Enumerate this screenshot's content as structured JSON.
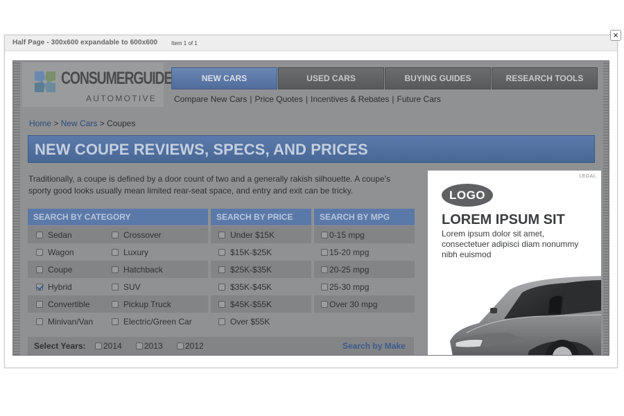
{
  "modal": {
    "title": "Half Page - 300x600 expandable to 600x600",
    "count": "Item 1 of 1",
    "close": "×"
  },
  "site": {
    "logo_title": "CONSUMERGUIDE",
    "logo_reg": "®",
    "logo_sub": "AUTOMOTIVE",
    "nav": [
      {
        "label": "NEW CARS",
        "active": true
      },
      {
        "label": "USED CARS",
        "active": false
      },
      {
        "label": "BUYING GUIDES",
        "active": false
      },
      {
        "label": "RESEARCH TOOLS",
        "active": false
      }
    ],
    "subnav": [
      "Compare New Cars",
      "Price Quotes",
      "Incentives & Rebates",
      "Future Cars"
    ],
    "subnav_sep": "|",
    "breadcrumb": [
      "Home",
      "New Cars",
      "Coupes"
    ],
    "breadcrumb_sep": ">",
    "page_title": "NEW COUPE REVIEWS, SPECS, AND PRICES",
    "intro": "Traditionally, a coupe is defined by a door count of two and a generally rakish silhouette. A coupe's sporty good looks usually mean limited rear-seat space, and entry and exit can be tricky."
  },
  "search": {
    "category": {
      "header": "SEARCH BY CATEGORY",
      "options": [
        {
          "label": "Sedan",
          "checked": false
        },
        {
          "label": "Crossover",
          "checked": false
        },
        {
          "label": "Wagon",
          "checked": false
        },
        {
          "label": "Luxury",
          "checked": false
        },
        {
          "label": "Coupe",
          "checked": false
        },
        {
          "label": "Hatchback",
          "checked": false
        },
        {
          "label": "Hybrid",
          "checked": true
        },
        {
          "label": "SUV",
          "checked": false
        },
        {
          "label": "Convertible",
          "checked": false
        },
        {
          "label": "Pickup Truck",
          "checked": false
        },
        {
          "label": "Minivan/Van",
          "checked": false
        },
        {
          "label": "Electric/Green Car",
          "checked": false
        }
      ]
    },
    "price": {
      "header": "SEARCH BY PRICE",
      "options": [
        "Under $15K",
        "$15K-$25K",
        "$25K-$35K",
        "$35K-$45K",
        "$45K-$55K",
        "Over $55K"
      ]
    },
    "mpg": {
      "header": "SEARCH BY MPG",
      "options": [
        "0-15 mpg",
        "15-20 mpg",
        "20-25 mpg",
        "25-30 mpg",
        "Over 30 mpg"
      ]
    },
    "years_label": "Select Years:",
    "years": [
      "2014",
      "2013",
      "2012"
    ],
    "make_link": "Search by Make"
  },
  "ad": {
    "legal": "LEGAL",
    "logo": "LOGO",
    "headline": "LOREM IPSUM SIT",
    "body": "Lorem ipsum dolor sit amet, consectetuer adipisci diam nonummy nibh euismod"
  },
  "colors": {
    "overlay_gray": "#909193",
    "nav_active_blue": "#5c7aab",
    "column_header_blue": "#5b79a8"
  }
}
